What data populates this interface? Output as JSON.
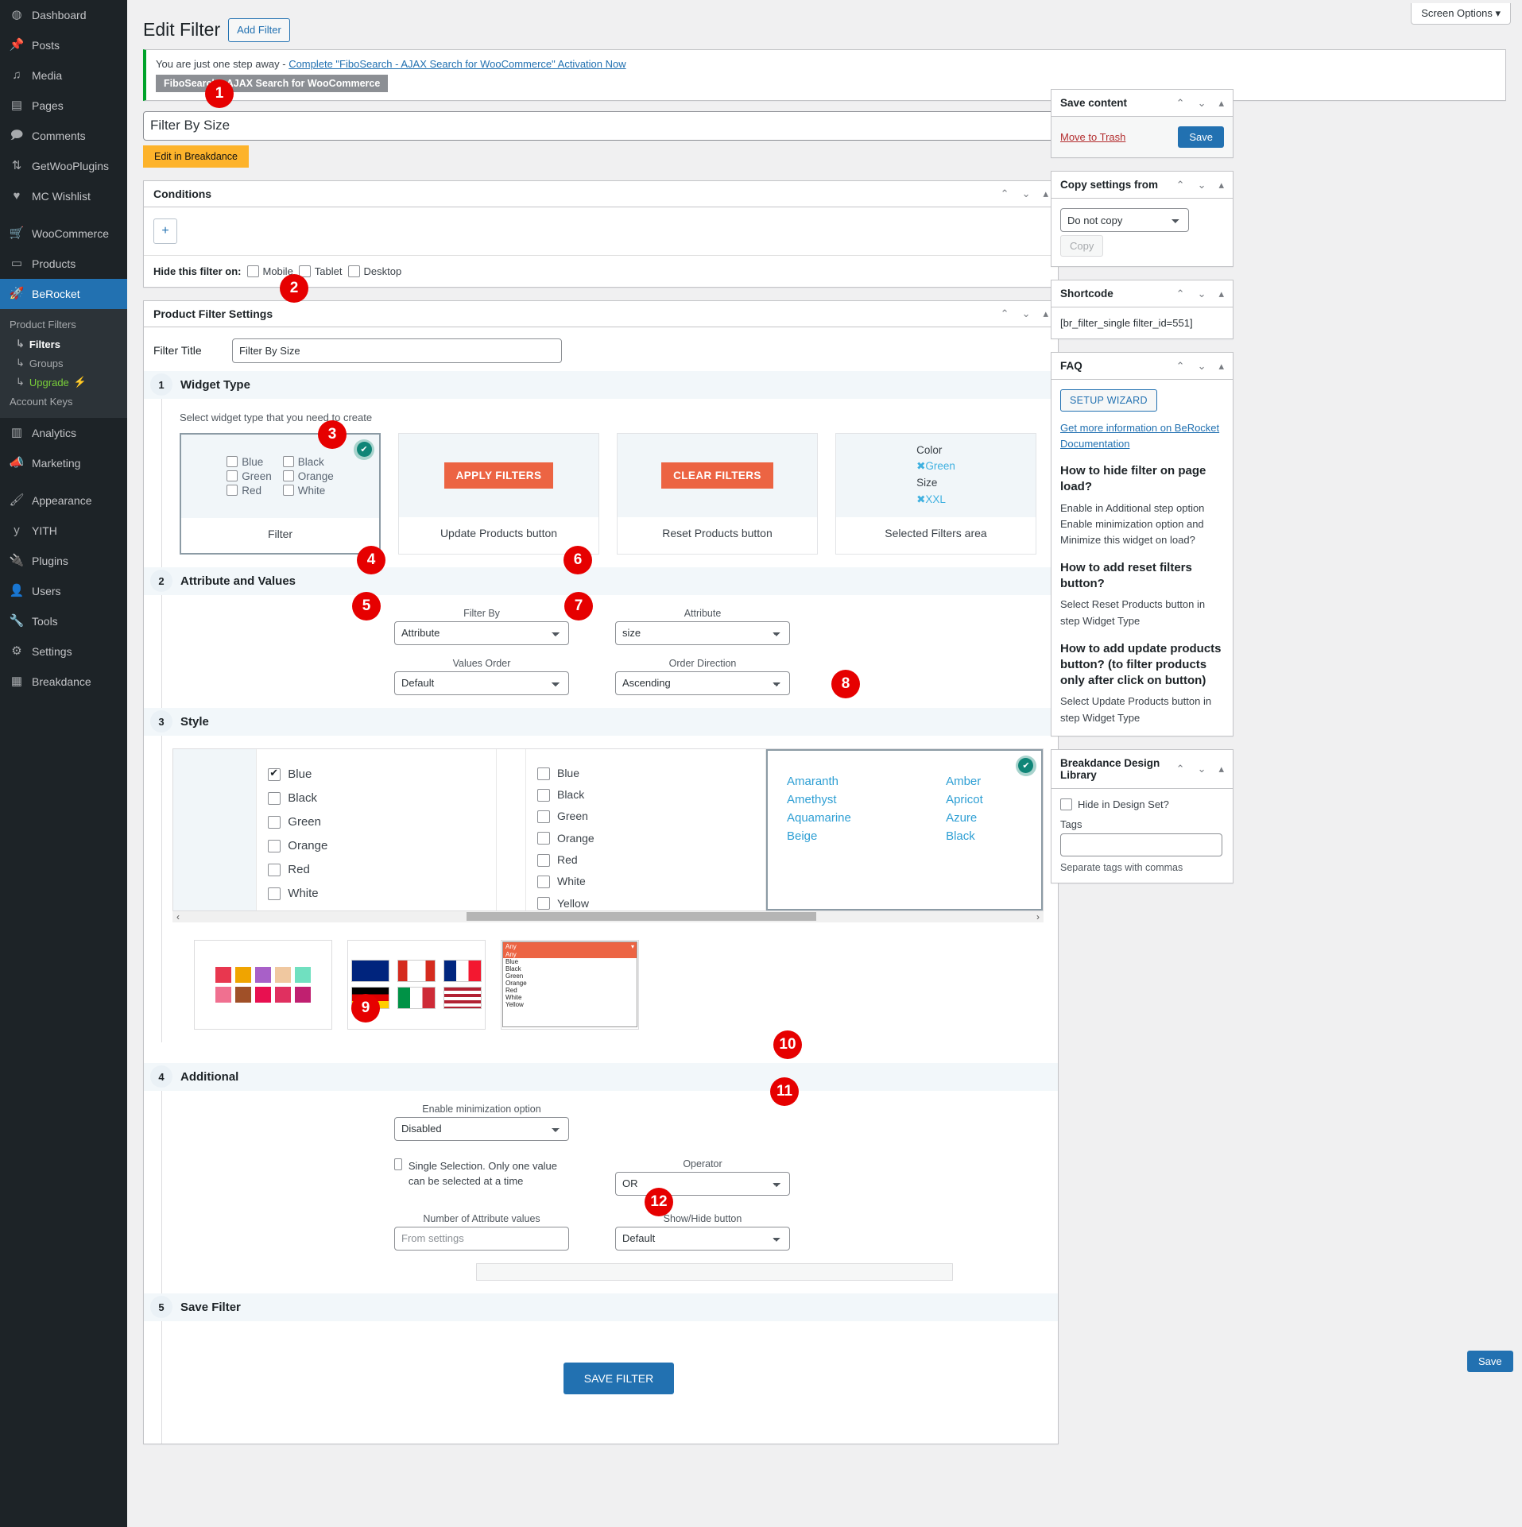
{
  "sidebar": {
    "items": [
      {
        "label": "Dashboard",
        "icon": "dashboard-icon"
      },
      {
        "label": "Posts",
        "icon": "pin-icon"
      },
      {
        "label": "Media",
        "icon": "media-icon"
      },
      {
        "label": "Pages",
        "icon": "pages-icon"
      },
      {
        "label": "Comments",
        "icon": "comment-icon"
      },
      {
        "label": "GetWooPlugins",
        "icon": "sliders-icon"
      },
      {
        "label": "MC Wishlist",
        "icon": "heart-icon"
      },
      {
        "label": "WooCommerce",
        "icon": "woo-icon"
      },
      {
        "label": "Products",
        "icon": "products-icon"
      },
      {
        "label": "BeRocket",
        "icon": "rocket-icon"
      }
    ],
    "submenu": {
      "product_filters_heading": "Product Filters",
      "filters": "Filters",
      "groups": "Groups",
      "upgrade": "Upgrade",
      "upgrade_icon": "lightning-icon",
      "account_keys_heading": "Account Keys"
    },
    "items_after": [
      {
        "label": "Analytics",
        "icon": "chart-icon"
      },
      {
        "label": "Marketing",
        "icon": "megaphone-icon"
      },
      {
        "label": "Appearance",
        "icon": "brush-icon"
      },
      {
        "label": "YITH",
        "icon": "yith-icon"
      },
      {
        "label": "Plugins",
        "icon": "plug-icon"
      },
      {
        "label": "Users",
        "icon": "user-icon"
      },
      {
        "label": "Tools",
        "icon": "tools-icon"
      },
      {
        "label": "Settings",
        "icon": "gear-icon"
      },
      {
        "label": "Breakdance",
        "icon": "breakdance-icon"
      }
    ]
  },
  "header": {
    "screen_options": "Screen Options",
    "screen_options_icon": "chevron-down-icon",
    "page_title": "Edit Filter",
    "add_filter_button": "Add Filter"
  },
  "notice": {
    "text": "You are just one step away - ",
    "link": "Complete \"FiboSearch - AJAX Search for WooCommerce\" Activation Now",
    "plugin_tag": "FiboSearch - AJAX Search for WooCommerce"
  },
  "title_input": {
    "value": "Filter By Size"
  },
  "breakdance_button": "Edit in Breakdance",
  "conditions": {
    "heading": "Conditions",
    "add_icon": "plus-icon",
    "hide_label": "Hide this filter on:",
    "devices": [
      "Mobile",
      "Tablet",
      "Desktop"
    ]
  },
  "settings": {
    "heading": "Product Filter Settings",
    "filter_title_label": "Filter Title",
    "filter_title_value": "Filter By Size"
  },
  "step1": {
    "num": "1",
    "title": "Widget Type",
    "hint": "Select widget type that you need to create",
    "cards": [
      {
        "label": "Filter",
        "type": "checkbox-list",
        "selected": true,
        "checkboxes": [
          "Blue",
          "Black",
          "Green",
          "Orange",
          "Red",
          "White"
        ]
      },
      {
        "label": "Update Products button",
        "type": "button",
        "button_text": "APPLY FILTERS",
        "selected": false
      },
      {
        "label": "Reset Products button",
        "type": "button",
        "button_text": "CLEAR FILTERS",
        "selected": false
      },
      {
        "label": "Selected Filters area",
        "type": "selected-area",
        "selected": false,
        "lines": [
          "Color",
          "Green",
          "Size",
          "XXL"
        ]
      }
    ]
  },
  "step2": {
    "num": "2",
    "title": "Attribute and Values",
    "fields": [
      {
        "label": "Filter By",
        "value": "Attribute"
      },
      {
        "label": "Values Order",
        "value": "Default"
      },
      {
        "label": "Attribute",
        "value": "size"
      },
      {
        "label": "Order Direction",
        "value": "Ascending"
      }
    ]
  },
  "step3": {
    "num": "3",
    "title": "Style",
    "list_items": [
      "Blue",
      "Black",
      "Green",
      "Orange",
      "Red",
      "White",
      "Yellow"
    ],
    "list_checked_first": true,
    "color_links_left": [
      "Amaranth",
      "Amethyst",
      "Aquamarine",
      "Beige"
    ],
    "color_links_right": [
      "Amber",
      "Apricot",
      "Azure",
      "Black"
    ],
    "mini_select": {
      "header": "Any",
      "options": [
        "Any",
        "Blue",
        "Black",
        "Green",
        "Orange",
        "Red",
        "White",
        "Yellow"
      ]
    },
    "swatch_colors": [
      "#e8374f",
      "#f0a400",
      "#a860c8",
      "#f0c8a0",
      "#70e0c0",
      "#f07090",
      "#a05028",
      "#e81050",
      "#e03060",
      "#c02070"
    ],
    "scroll_left_icon": "chevron-left-icon",
    "scroll_right_icon": "chevron-right-icon"
  },
  "step4": {
    "num": "4",
    "title": "Additional",
    "minimization_label": "Enable minimization option",
    "minimization_value": "Disabled",
    "single_selection_label": "Single Selection. Only one value can be selected at a time",
    "operator_label": "Operator",
    "operator_value": "OR",
    "num_attr_label": "Number of Attribute values",
    "num_attr_placeholder": "From settings",
    "showhide_label": "Show/Hide button",
    "showhide_value": "Default"
  },
  "step5": {
    "num": "5",
    "title": "Save Filter",
    "save_button": "SAVE FILTER"
  },
  "sidebar_right": {
    "save_content": {
      "heading": "Save content",
      "trash": "Move to Trash",
      "save": "Save"
    },
    "copy_settings": {
      "heading": "Copy settings from",
      "select_value": "Do not copy",
      "copy_button": "Copy"
    },
    "shortcode": {
      "heading": "Shortcode",
      "value": "[br_filter_single filter_id=551]"
    },
    "faq": {
      "heading": "FAQ",
      "wizard_button": "SETUP WIZARD",
      "doc_link": "Get more information on BeRocket Documentation",
      "entries": [
        {
          "q": "How to hide filter on page load?",
          "a": "Enable in Additional step option Enable minimization option and Minimize this widget on load?"
        },
        {
          "q": "How to add reset filters button?",
          "a": "Select Reset Products button in step Widget Type"
        },
        {
          "q": "How to add update products button? (to filter products only after click on button)",
          "a": "Select Update Products button in step Widget Type"
        }
      ]
    },
    "design_library": {
      "heading": "Breakdance Design Library",
      "hide_label": "Hide in Design Set?",
      "tags_label": "Tags",
      "tags_value": "",
      "tags_hint": "Separate tags with commas"
    },
    "float_save": "Save",
    "panel_icons": {
      "up": "chevron-up-icon",
      "down": "chevron-down-icon",
      "toggle": "caret-up-icon"
    }
  },
  "callouts": [
    "1",
    "2",
    "3",
    "4",
    "5",
    "6",
    "7",
    "8",
    "9",
    "10",
    "11",
    "12"
  ]
}
